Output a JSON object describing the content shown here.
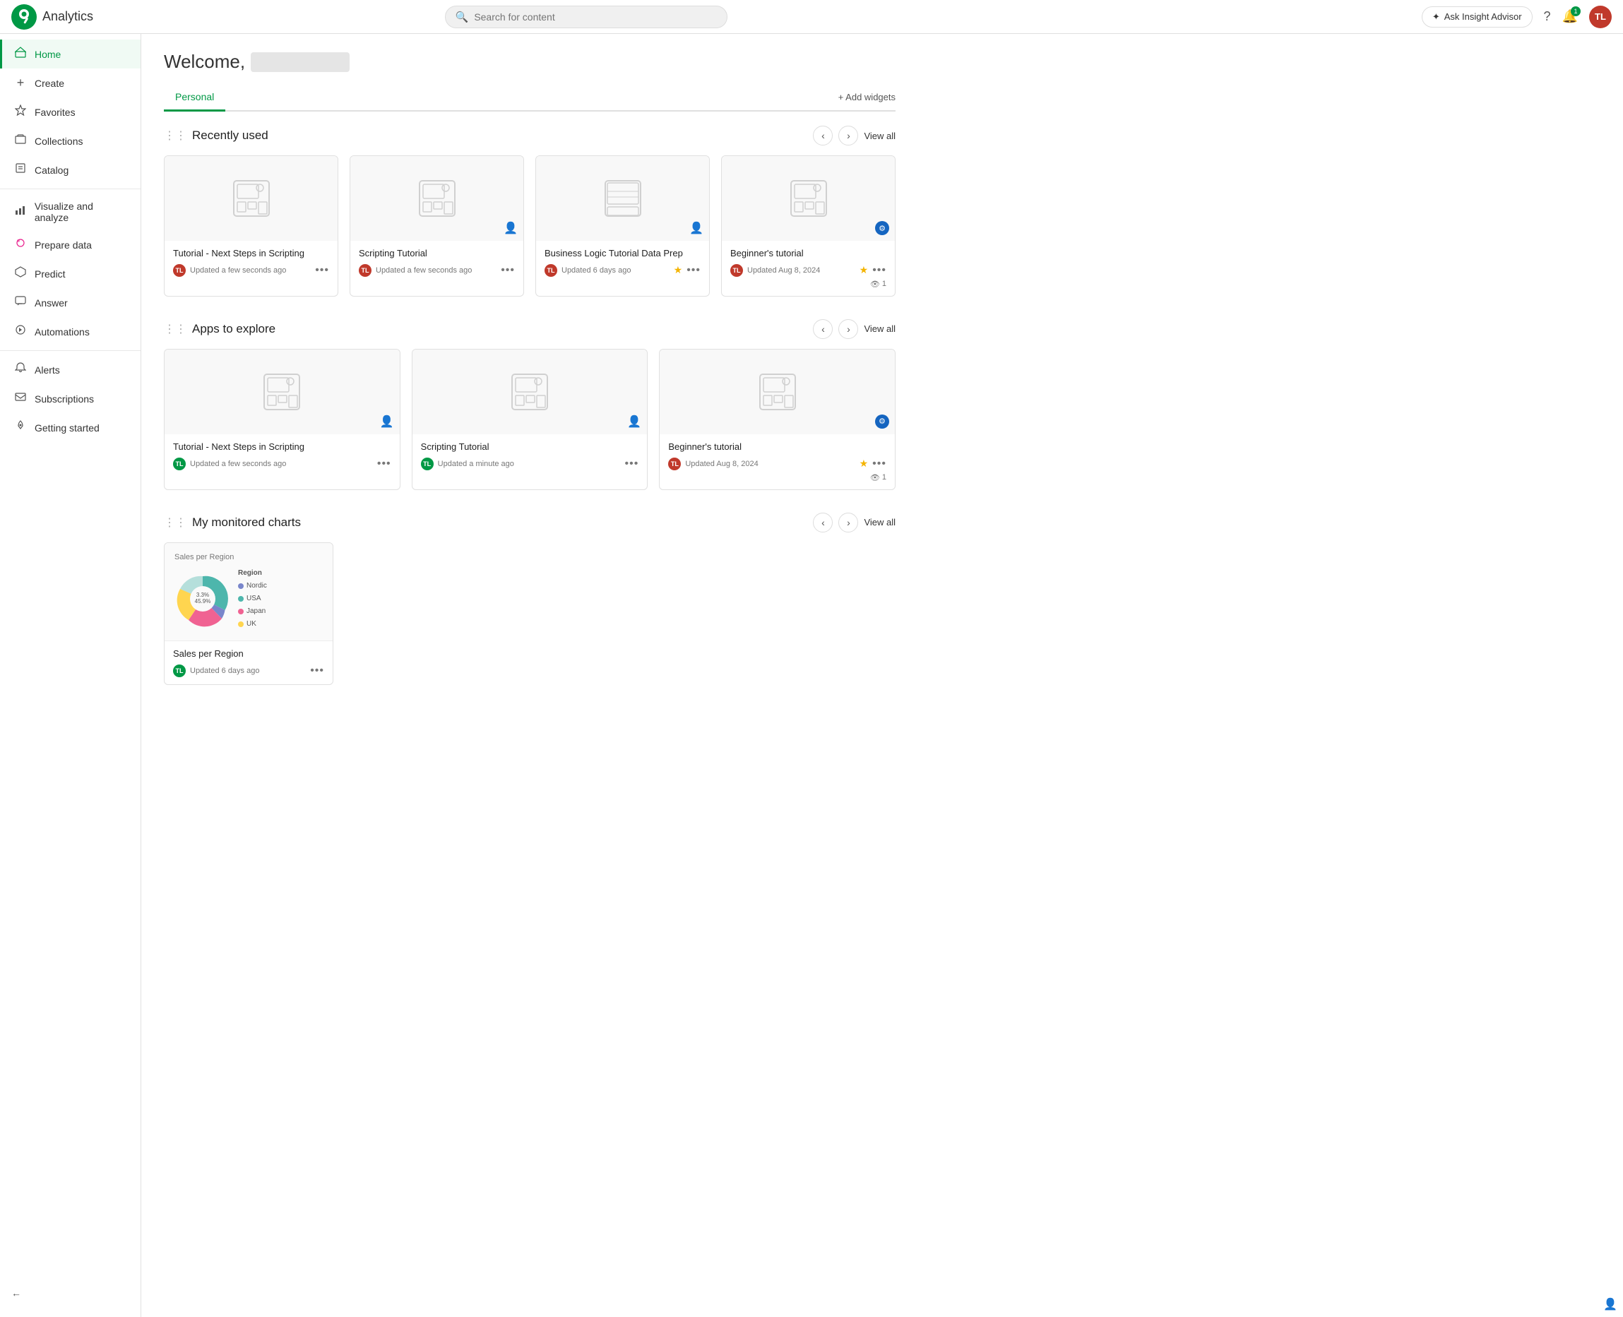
{
  "topbar": {
    "app_name": "Analytics",
    "search_placeholder": "Search for content",
    "insight_advisor_label": "Ask Insight Advisor",
    "notification_count": "1",
    "user_initials": "TL"
  },
  "sidebar": {
    "items": [
      {
        "id": "home",
        "label": "Home",
        "icon": "🏠",
        "active": true
      },
      {
        "id": "create",
        "label": "Create",
        "icon": "＋"
      },
      {
        "id": "favorites",
        "label": "Favorites",
        "icon": "☆"
      },
      {
        "id": "collections",
        "label": "Collections",
        "icon": "🗂"
      },
      {
        "id": "catalog",
        "label": "Catalog",
        "icon": "📋"
      },
      {
        "id": "visualize",
        "label": "Visualize and analyze",
        "icon": "📊"
      },
      {
        "id": "prepare",
        "label": "Prepare data",
        "icon": "🔮"
      },
      {
        "id": "predict",
        "label": "Predict",
        "icon": "⬡"
      },
      {
        "id": "answer",
        "label": "Answer",
        "icon": "💬"
      },
      {
        "id": "automations",
        "label": "Automations",
        "icon": "⚙"
      },
      {
        "id": "alerts",
        "label": "Alerts",
        "icon": "🔔"
      },
      {
        "id": "subscriptions",
        "label": "Subscriptions",
        "icon": "✉"
      },
      {
        "id": "getting-started",
        "label": "Getting started",
        "icon": "🚀"
      }
    ],
    "collapse_label": "←"
  },
  "main": {
    "welcome_text": "Welcome,",
    "tabs": [
      {
        "id": "personal",
        "label": "Personal",
        "active": true
      }
    ],
    "add_widgets_label": "+ Add widgets",
    "sections": {
      "recently_used": {
        "title": "Recently used",
        "view_all": "View all",
        "cards": [
          {
            "id": "card1",
            "title": "Tutorial - Next Steps in Scripting",
            "time": "Updated a few seconds ago",
            "avatar": "TL",
            "avatar_color": "red",
            "star": false,
            "views": null
          },
          {
            "id": "card2",
            "title": "Scripting Tutorial",
            "time": "Updated a few seconds ago",
            "avatar": "TL",
            "avatar_color": "red",
            "star": false,
            "views": null
          },
          {
            "id": "card3",
            "title": "Business Logic Tutorial Data Prep",
            "time": "Updated 6 days ago",
            "avatar": "TL",
            "avatar_color": "red",
            "star": true,
            "views": null
          },
          {
            "id": "card4",
            "title": "Beginner's tutorial",
            "time": "Updated Aug 8, 2024",
            "avatar": "TL",
            "avatar_color": "red",
            "star": true,
            "views": "1",
            "blue_badge": true
          }
        ]
      },
      "apps_to_explore": {
        "title": "Apps to explore",
        "view_all": "View all",
        "cards": [
          {
            "id": "ecard1",
            "title": "Tutorial - Next Steps in Scripting",
            "time": "Updated a few seconds ago",
            "avatar": "TL",
            "avatar_color": "green",
            "star": false,
            "views": null
          },
          {
            "id": "ecard2",
            "title": "Scripting Tutorial",
            "time": "Updated a minute ago",
            "avatar": "TL",
            "avatar_color": "green",
            "star": false,
            "views": null
          },
          {
            "id": "ecard3",
            "title": "Beginner's tutorial",
            "time": "Updated Aug 8, 2024",
            "avatar": "TL",
            "avatar_color": "red",
            "star": true,
            "views": "1",
            "blue_badge": true
          }
        ]
      },
      "monitored_charts": {
        "title": "My monitored charts",
        "view_all": "View all",
        "cards": [
          {
            "id": "chart1",
            "title": "Sales per Region",
            "time": "Updated 6 days ago",
            "avatar": "TL",
            "avatar_color": "green",
            "chart_title": "Sales per Region",
            "legend_label": "Region",
            "donut_segments": [
              {
                "label": "USA",
                "value": 45.9,
                "color": "#4db6ac"
              },
              {
                "label": "Nordic",
                "value": 3.3,
                "color": "#7986cb"
              },
              {
                "label": "Japan",
                "value": 12.3,
                "color": "#f06292"
              },
              {
                "label": "UK",
                "value": 26.9,
                "color": "#ffd54f"
              }
            ]
          }
        ]
      }
    }
  }
}
